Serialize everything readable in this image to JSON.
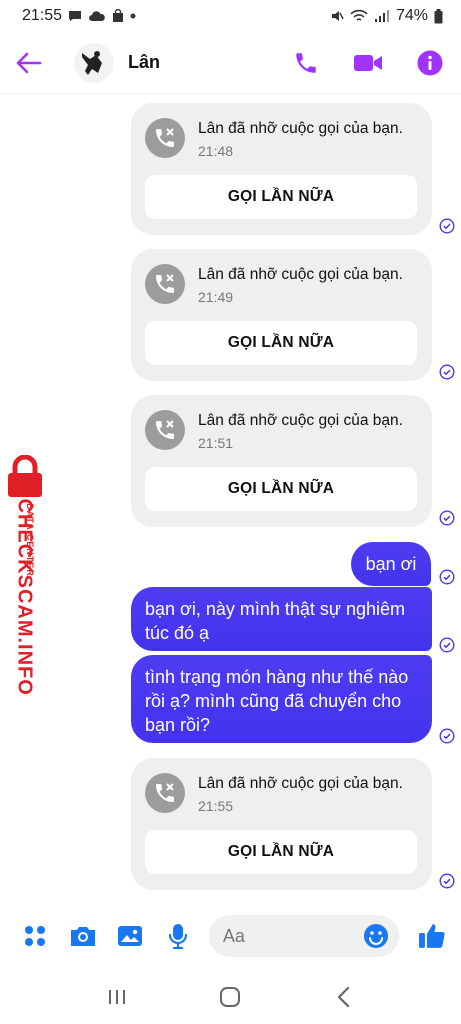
{
  "status_bar": {
    "time": "21:55",
    "battery": "74%"
  },
  "header": {
    "contact_name": "Lân",
    "accent_color": "#a033ff"
  },
  "messages": [
    {
      "type": "missed_call",
      "text": "Lân đã nhỡ cuộc gọi của bạn.",
      "time": "21:48",
      "button_label": "GỌI LẦN NỮA"
    },
    {
      "type": "missed_call",
      "text": "Lân đã nhỡ cuộc gọi của bạn.",
      "time": "21:49",
      "button_label": "GỌI LẦN NỮA"
    },
    {
      "type": "missed_call",
      "text": "Lân đã nhỡ cuộc gọi của bạn.",
      "time": "21:51",
      "button_label": "GỌI LẦN NỮA"
    },
    {
      "type": "sent",
      "text": "bạn ơi"
    },
    {
      "type": "sent",
      "text": "bạn ơi, này mình thật sự nghiêm túc đó ạ"
    },
    {
      "type": "sent",
      "text": "tình trạng món hàng như thế nào rồi ạ? mình cũng đã chuyển cho bạn rồi?"
    },
    {
      "type": "missed_call",
      "text": "Lân đã nhỡ cuộc gọi của bạn.",
      "time": "21:55",
      "button_label": "GỌI LẦN NỮA"
    }
  ],
  "watermark": {
    "main": "CHECKSCAM.INFO",
    "sub": "DATA CENTER",
    "color": "#e01f26"
  },
  "composer": {
    "placeholder": "Aa",
    "accent_color": "#1877f2"
  },
  "colors": {
    "sent_bubble": "#4a38f2",
    "call_card": "#efefef"
  }
}
